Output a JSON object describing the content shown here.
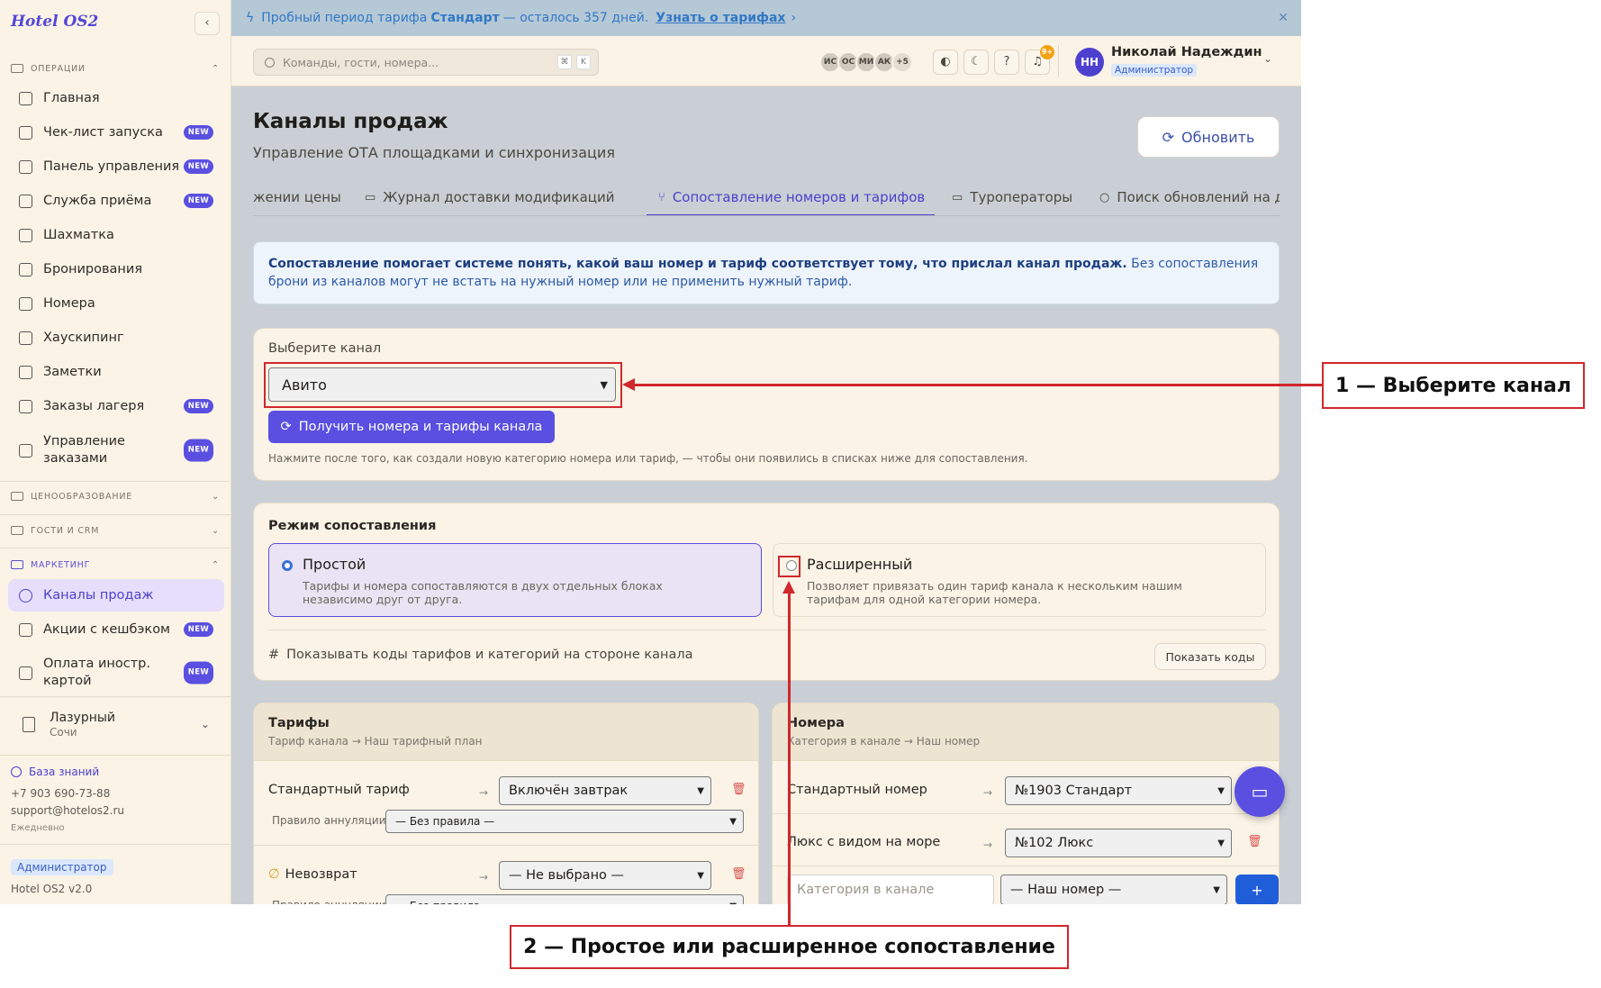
{
  "app": {
    "logo": "Hotel OS2"
  },
  "sidebar": {
    "sections": {
      "operations": "ОПЕРАЦИИ",
      "pricing": "ЦЕНООБРАЗОВАНИЕ",
      "guests": "ГОСТИ И CRM",
      "marketing": "МАРКЕТИНГ"
    },
    "items": [
      {
        "label": "Главная"
      },
      {
        "label": "Чек-лист запуска",
        "badge": "NEW"
      },
      {
        "label": "Панель управления",
        "badge": "NEW"
      },
      {
        "label": "Служба приёма",
        "badge": "NEW"
      },
      {
        "label": "Шахматка"
      },
      {
        "label": "Бронирования"
      },
      {
        "label": "Номера"
      },
      {
        "label": "Хаускипинг"
      },
      {
        "label": "Заметки"
      },
      {
        "label": "Заказы лагеря",
        "badge": "NEW"
      },
      {
        "label": "Управление заказами",
        "badge": "NEW"
      },
      {
        "label": "Каналы продаж"
      },
      {
        "label": "Акции с кешбэком",
        "badge": "NEW"
      },
      {
        "label": "Оплата иностр. картой",
        "badge": "NEW"
      }
    ],
    "hotel": {
      "name": "Лазурный",
      "city": "Сочи"
    },
    "knowledge_base": "База знаний",
    "phone": "+7 903 690-73-88",
    "email": "support@hotelos2.ru",
    "hours": "Ежедневно",
    "role": "Администратор",
    "version": "Hotel OS2 v2.0"
  },
  "banner": {
    "prefix": "Пробный период тарифа",
    "plan": "Стандарт",
    "suffix": "— осталось 357 дней.",
    "link": "Узнать о тарифах"
  },
  "topbar": {
    "search_placeholder": "Команды, гости, номера...",
    "kbd1": "⌘",
    "kbd2": "K",
    "avatars": [
      "ИС",
      "ОС",
      "МИ",
      "АК",
      "+5"
    ],
    "notif_count": "9+",
    "user_initials": "НН",
    "user_name": "Николай Надеждин",
    "user_role": "Администратор"
  },
  "page": {
    "title": "Каналы продаж",
    "subtitle": "Управление ОТА площадками и синхронизация",
    "refresh": "Обновить",
    "tabs": [
      "жении цены",
      "Журнал доставки модификаций",
      "Сопоставление номеров и тарифов",
      "Туроператоры",
      "Поиск обновлений на дат"
    ],
    "info_bold": "Сопоставление помогает системе понять, какой ваш номер и тариф соответствует тому, что прислал канал продаж.",
    "info_text": "Без сопоставления брони из каналов могут не встать на нужный номер или не применить нужный тариф."
  },
  "channel": {
    "label": "Выберите канал",
    "selected": "Авито",
    "fetch_button": "Получить номера и тарифы канала",
    "hint": "Нажмите после того, как создали новую категорию номера или тариф, — чтобы они появились в списках ниже для сопоставления."
  },
  "mode": {
    "title": "Режим сопоставления",
    "simple_name": "Простой",
    "simple_desc": "Тарифы и номера сопоставляются в двух отдельных блоках независимо друг от друга.",
    "advanced_name": "Расширенный",
    "advanced_desc": "Позволяет привязать один тариф канала к нескольким нашим тарифам для одной категории номера.",
    "codes_text": "Показывать коды тарифов и категорий на стороне канала",
    "codes_button": "Показать коды"
  },
  "tariffs": {
    "title": "Тарифы",
    "subtitle": "Тариф канала → Наш тарифный план",
    "rows": [
      {
        "name": "Стандартный тариф",
        "value": "Включён завтрак"
      },
      {
        "name": "Невозврат",
        "value": "— Не выбрано —"
      }
    ],
    "rule_label": "Правило аннуляции",
    "rule_value": "— Без правила —",
    "arrow": "→"
  },
  "rooms": {
    "title": "Номера",
    "subtitle": "Категория в канале → Наш номер",
    "rows": [
      {
        "name": "Стандартный номер",
        "value": "№1903 Стандарт"
      },
      {
        "name": "Люкс с видом на море",
        "value": "№102 Люкс"
      }
    ],
    "new_placeholder": "Категория в канале",
    "new_select": "— Наш номер —",
    "add": "+"
  },
  "annotations": {
    "step1": "1 — Выберите канал",
    "step2": "2 — Простое или расширенное сопоставление"
  },
  "colors": {
    "accent": "#5a4fe0",
    "annotation": "#d0282d",
    "sidebar_bg": "#faf3e6"
  }
}
